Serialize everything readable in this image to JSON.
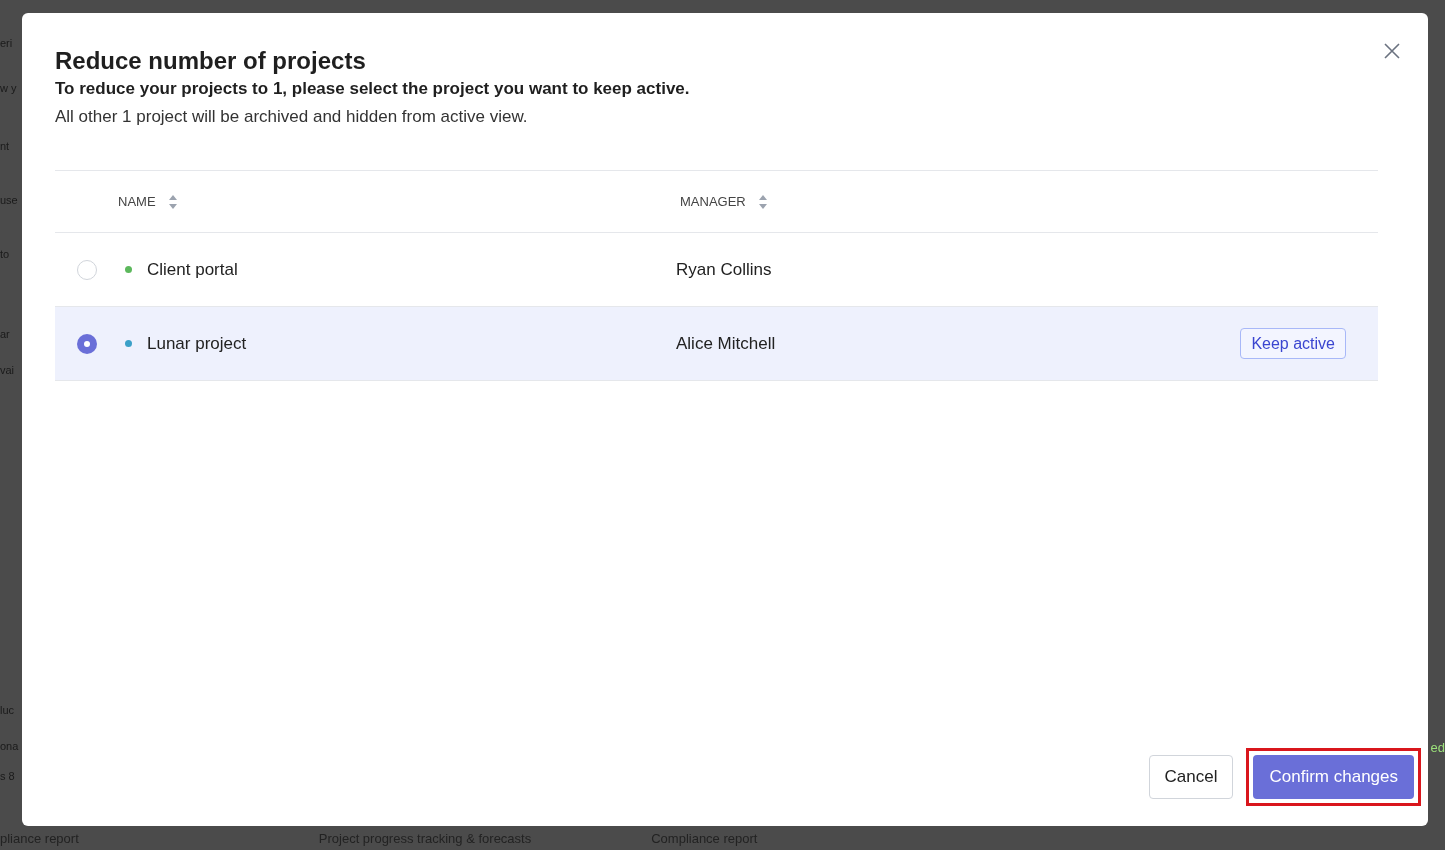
{
  "background": {
    "left_fragments": [
      "eri",
      "w y",
      "nt",
      "use",
      "to",
      "ar",
      "vai",
      "luc",
      "ona",
      "s 8"
    ],
    "right_fragment": "ed",
    "bottom_texts": [
      "pliance report",
      "Project progress tracking & forecasts",
      "Compliance report"
    ]
  },
  "dialog": {
    "title": "Reduce number of projects",
    "instruction": "To reduce your projects to 1, please select the project you want to keep active.",
    "note": "All other 1 project will be archived and hidden from active view.",
    "table": {
      "columns": [
        "NAME",
        "MANAGER"
      ],
      "rows": [
        {
          "name": "Client portal",
          "manager": "Ryan Collins",
          "color": "#5cb85c",
          "selected": false
        },
        {
          "name": "Lunar project",
          "manager": "Alice Mitchell",
          "color": "#3aa0c8",
          "selected": true,
          "action": "Keep active"
        }
      ]
    },
    "buttons": [
      {
        "label": "Cancel",
        "kind": "secondary",
        "highlighted": false
      },
      {
        "label": "Confirm changes",
        "kind": "primary",
        "highlighted": true
      }
    ]
  }
}
